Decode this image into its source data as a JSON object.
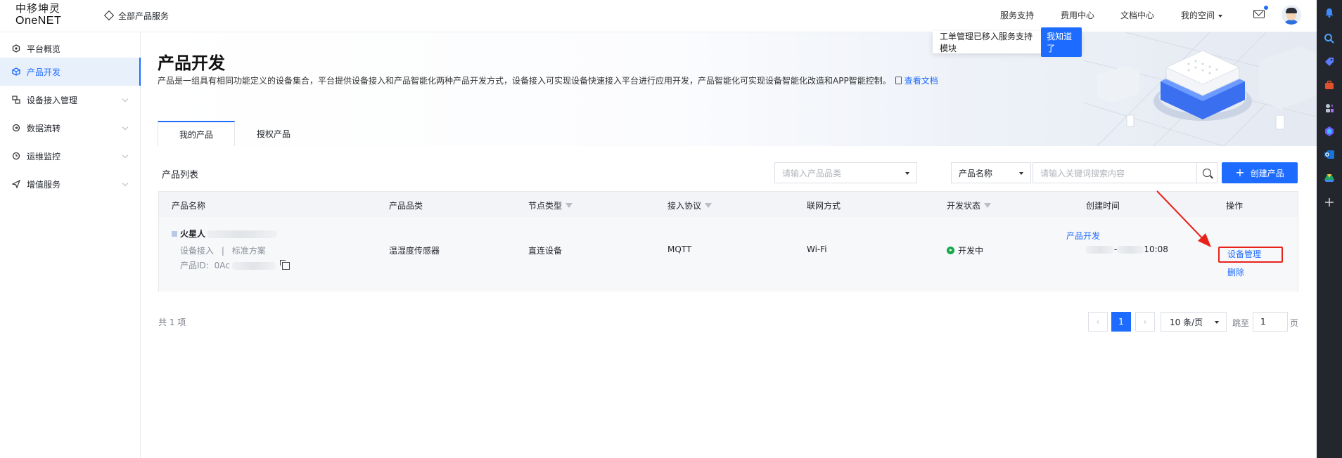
{
  "brand": {
    "line1": "中移坤灵",
    "line2": "OneNET"
  },
  "header": {
    "all_products": "全部产品服务",
    "nav": [
      "服务支持",
      "费用中心",
      "文档中心",
      "我的空间"
    ]
  },
  "notice": {
    "text": "工单管理已移入服务支持模块",
    "button": "我知道了"
  },
  "sidebar": {
    "items": [
      {
        "label": "平台概览"
      },
      {
        "label": "产品开发"
      },
      {
        "label": "设备接入管理"
      },
      {
        "label": "数据流转"
      },
      {
        "label": "运维监控"
      },
      {
        "label": "增值服务"
      }
    ]
  },
  "page": {
    "title": "产品开发",
    "description": "产品是一组具有相同功能定义的设备集合，平台提供设备接入和产品智能化两种产品开发方式，设备接入可实现设备快速接入平台进行应用开发，产品智能化可实现设备智能化改造和APP智能控制。",
    "doc_link": "查看文档",
    "tabs": [
      "我的产品",
      "授权产品"
    ]
  },
  "list": {
    "title": "产品列表",
    "category_placeholder": "请输入产品品类",
    "field_select": "产品名称",
    "keyword_placeholder": "请输入关键词搜索内容",
    "create_button": "创建产品"
  },
  "table": {
    "columns": [
      "产品名称",
      "产品品类",
      "节点类型",
      "接入协议",
      "联网方式",
      "开发状态",
      "创建时间",
      "操作"
    ],
    "rows": [
      {
        "name": "火星人",
        "access": "设备接入",
        "separator": "|",
        "scheme": "标准方案",
        "id_label": "产品ID:",
        "id_value": "0Ac",
        "category": "温湿度传感器",
        "node_type": "直连设备",
        "protocol": "MQTT",
        "network": "Wi-Fi",
        "status": "开发中",
        "created_partial": "-",
        "created_time": "10:08",
        "actions": [
          "产品开发",
          "设备管理",
          "删除"
        ]
      }
    ]
  },
  "pagination": {
    "total": "共 1 项",
    "prev": "‹",
    "current": "1",
    "next": "›",
    "page_size": "10 条/页",
    "jump_label": "跳至",
    "jump_value": "1",
    "page_suffix": "页"
  },
  "colors": {
    "primary": "#1e6cff",
    "highlight": "#e8221b",
    "status_ok": "#14a84a"
  },
  "icons": {
    "rail": [
      "bell-icon",
      "search-icon",
      "tag-icon",
      "toolbox-icon",
      "chess-icon",
      "copilot-icon",
      "outlook-icon",
      "drive-icon",
      "plus-icon"
    ]
  }
}
